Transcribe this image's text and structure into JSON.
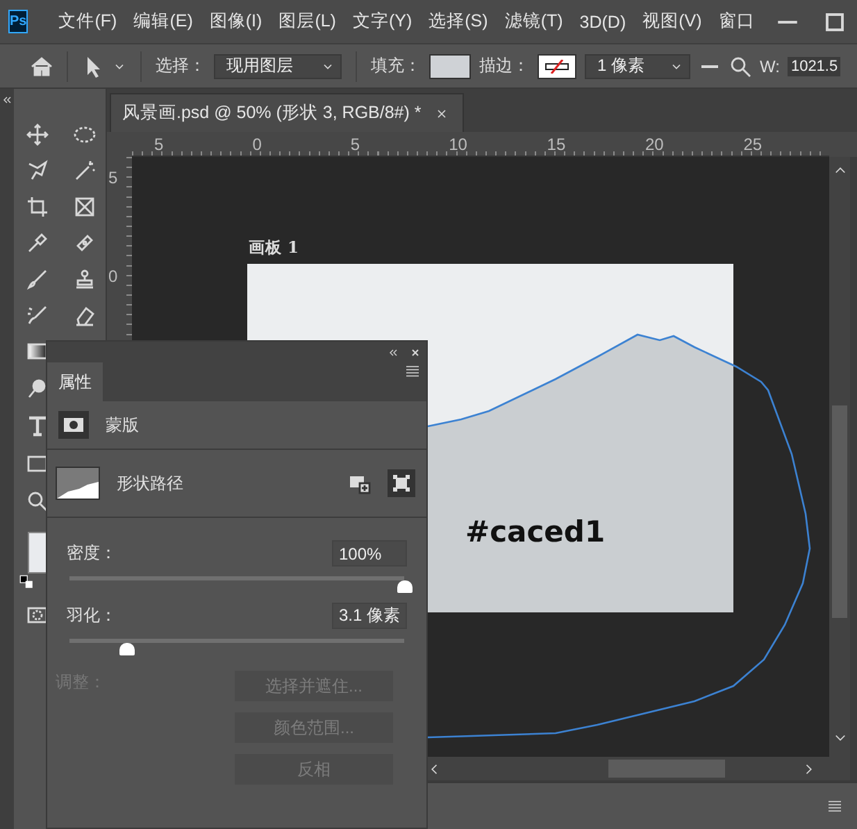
{
  "window": {
    "app_icon": "Ps"
  },
  "menu": [
    {
      "label": "文件(F)"
    },
    {
      "label": "编辑(E)"
    },
    {
      "label": "图像(I)"
    },
    {
      "label": "图层(L)"
    },
    {
      "label": "文字(Y)"
    },
    {
      "label": "选择(S)"
    },
    {
      "label": "滤镜(T)"
    },
    {
      "label": "3D(D)"
    },
    {
      "label": "视图(V)"
    },
    {
      "label": "窗口"
    }
  ],
  "options_bar": {
    "select_label": "选择：",
    "select_value": "现用图层",
    "fill_label": "填充：",
    "stroke_label": "描边：",
    "stroke_width": "1 像素",
    "w_label": "W:",
    "w_value": "1021.5"
  },
  "document_tab": {
    "title": "风景画.psd @ 50% (形状 3, RGB/8#) *",
    "selected": true
  },
  "ruler": {
    "horizontal": [
      "5",
      "0",
      "5",
      "10",
      "15",
      "20",
      "25"
    ],
    "vertical": [
      "5",
      "0"
    ]
  },
  "artboard": {
    "label": "画板 1",
    "annotation": "#caced1"
  },
  "properties_panel": {
    "tab": "属性",
    "section": "蒙版",
    "shape_label": "形状路径",
    "sliders": [
      {
        "label": "密度：",
        "value": "100%",
        "level": 1
      },
      {
        "label": "羽化：",
        "value": "3.1 像素",
        "level": 0.17
      }
    ],
    "adjust_label": "调整：",
    "buttons": [
      {
        "label": "选择并遮住...",
        "disabled": true
      },
      {
        "label": "颜色范围...",
        "disabled": true
      },
      {
        "label": "反相",
        "disabled": true
      }
    ]
  }
}
